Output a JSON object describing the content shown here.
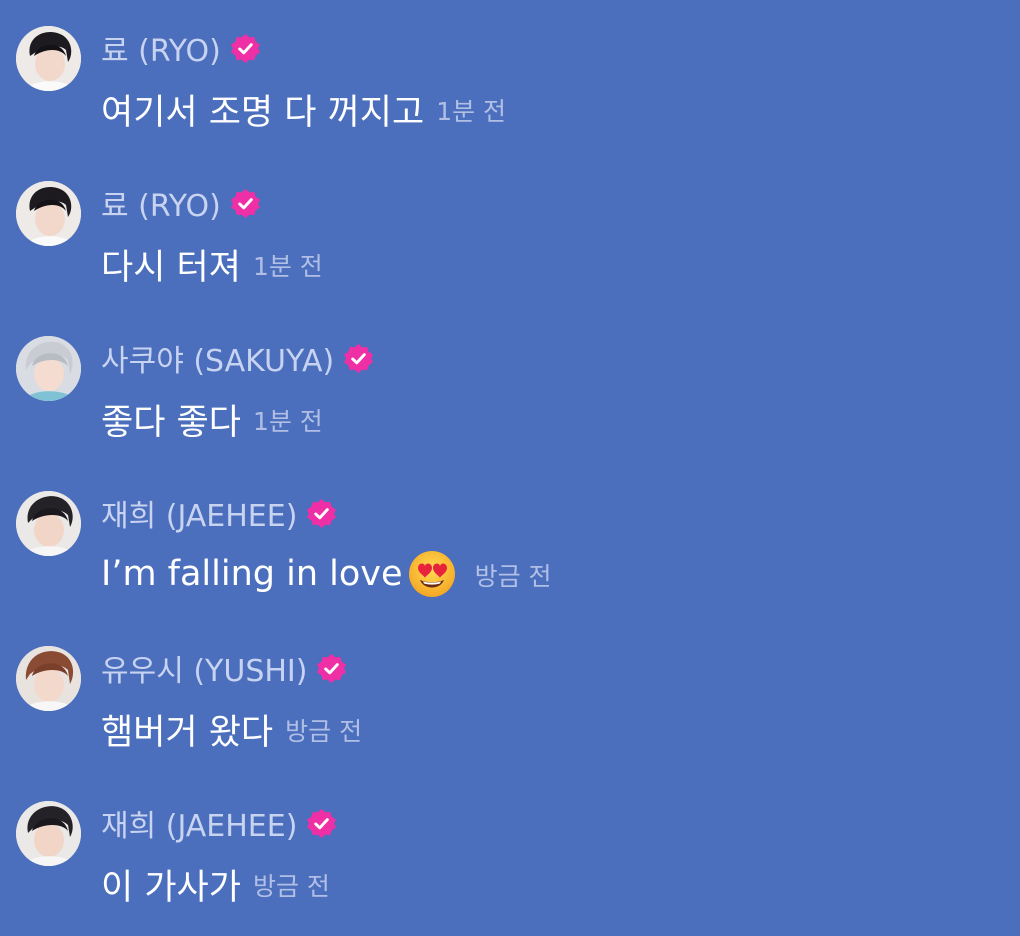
{
  "colors": {
    "background": "#4b6fbc",
    "name_text": "#c8d3f1",
    "message_text": "#ffffff",
    "time_text": "#b1bfe6",
    "verified_badge": "#ef2fa6"
  },
  "messages": [
    {
      "name": "료 (RYO)",
      "text": "여기서 조명 다 꺼지고",
      "time": "1분 전",
      "avatar_icon": "avatar-ryo",
      "verified": true
    },
    {
      "name": "료 (RYO)",
      "text": "다시 터져",
      "time": "1분 전",
      "avatar_icon": "avatar-ryo",
      "verified": true
    },
    {
      "name": "사쿠야 (SAKUYA)",
      "text": "좋다 좋다",
      "time": "1분 전",
      "avatar_icon": "avatar-sakuya",
      "verified": true
    },
    {
      "name": "재희 (JAEHEE)",
      "text": "I’m falling in love",
      "emoji": "heart-eyes-emoji",
      "time": "방금 전",
      "avatar_icon": "avatar-jaehee",
      "verified": true
    },
    {
      "name": "유우시 (YUSHI)",
      "text": "햄버거 왔다",
      "time": "방금 전",
      "avatar_icon": "avatar-yushi",
      "verified": true
    },
    {
      "name": "재희 (JAEHEE)",
      "text": "이 가사가",
      "time": "방금 전",
      "avatar_icon": "avatar-jaehee",
      "verified": true
    }
  ]
}
